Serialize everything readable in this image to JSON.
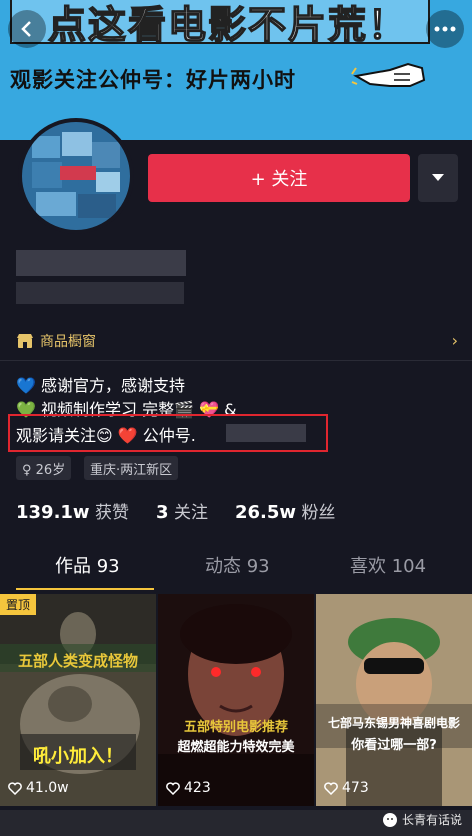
{
  "banner": {
    "headline": "点这看电影不片荒！",
    "subline": "观影关注公仲号：好片两小时",
    "color": "#37a8e0"
  },
  "profile": {
    "follow_label": "+ 关注",
    "shop_label": "商品橱窗",
    "bio_lines": [
      "💙 感谢官方，感谢支持",
      "💚 视频制作学习 完整🎬 💝 &",
      "观影请关注😊 ❤️ 公仲号."
    ],
    "tags": [
      "♀ 26岁",
      "重庆·两江新区"
    ],
    "stats": [
      {
        "value": "139.1w",
        "label": "获赞"
      },
      {
        "value": "3",
        "label": "关注"
      },
      {
        "value": "26.5w",
        "label": "粉丝"
      }
    ],
    "accent": "#e7304a"
  },
  "tabs": [
    {
      "label": "作品 93",
      "active": true
    },
    {
      "label": "动态 93",
      "active": false
    },
    {
      "label": "喜欢 104",
      "active": false
    }
  ],
  "videos": [
    {
      "pin": "置顶",
      "caption_top": "五部人类变成怪物",
      "caption_bottom": "吼小加入！",
      "likes": "41.0w"
    },
    {
      "caption_top": "五部特别电影推荐",
      "caption_bottom": "超燃超能力特效完美",
      "likes": "423"
    },
    {
      "caption_top": "七部马东锡男神喜剧电影",
      "caption_bottom": "你看过哪一部?",
      "likes": "473"
    }
  ],
  "watermark": "长青有话说"
}
